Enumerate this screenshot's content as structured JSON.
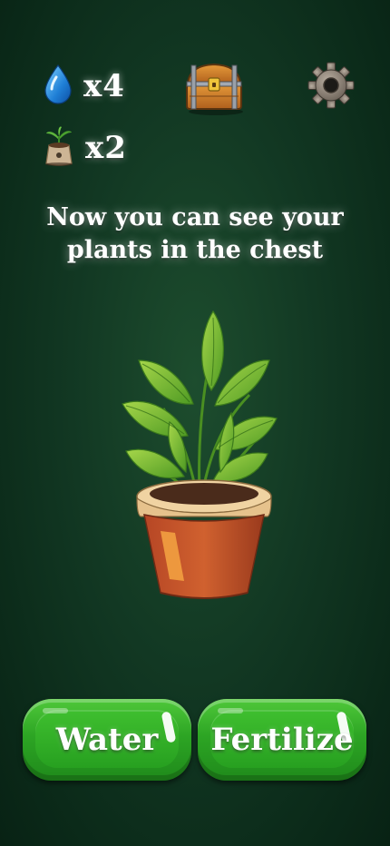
{
  "hud": {
    "water": {
      "count": "x4",
      "icon": "water-drop-icon"
    },
    "fertilizer": {
      "count": "x2",
      "icon": "seed-bag-icon"
    },
    "chest": {
      "icon": "treasure-chest-icon"
    },
    "settings": {
      "icon": "gear-icon"
    }
  },
  "message": {
    "line1": "Now you can see your",
    "line2": "plants in the chest"
  },
  "plant": {
    "icon": "potted-plant-icon"
  },
  "buttons": {
    "water_label": "Water",
    "fertilize_label": "Fertilize"
  },
  "colors": {
    "background": "#123823",
    "button_green": "#2da524",
    "pot": "#c8552e"
  }
}
